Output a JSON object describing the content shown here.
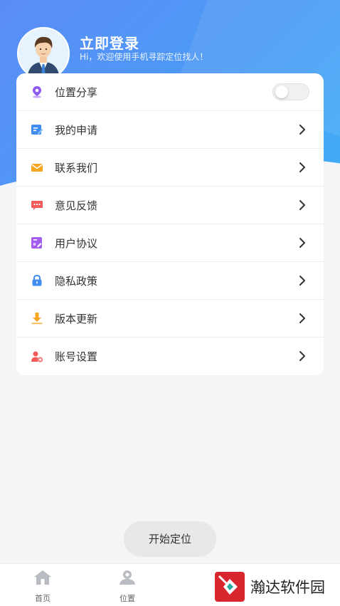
{
  "header": {
    "title": "立即登录",
    "subtitle": "Hi，欢迎使用手机寻踪定位找人！"
  },
  "menu": {
    "items": [
      {
        "label": "位置分享",
        "icon": "location-pin-icon",
        "color": "#8e5af0",
        "control": "toggle",
        "toggle_on": false
      },
      {
        "label": "我的申请",
        "icon": "edit-document-icon",
        "color": "#3f8df0",
        "control": "chevron"
      },
      {
        "label": "联系我们",
        "icon": "envelope-icon",
        "color": "#f5a623",
        "control": "chevron"
      },
      {
        "label": "意见反馈",
        "icon": "chat-bubble-icon",
        "color": "#f05a5a",
        "control": "chevron"
      },
      {
        "label": "用户协议",
        "icon": "agreement-icon",
        "color": "#a45cf0",
        "control": "chevron"
      },
      {
        "label": "隐私政策",
        "icon": "lock-icon",
        "color": "#3f8df0",
        "control": "chevron"
      },
      {
        "label": "版本更新",
        "icon": "download-icon",
        "color": "#f5a623",
        "control": "chevron"
      },
      {
        "label": "账号设置",
        "icon": "user-settings-icon",
        "color": "#f05a5a",
        "control": "chevron"
      }
    ]
  },
  "start_button": {
    "label": "开始定位"
  },
  "tabbar": {
    "tabs": [
      {
        "label": "首页",
        "icon": "home-icon"
      },
      {
        "label": "位置",
        "icon": "location-person-icon"
      }
    ]
  },
  "watermark": {
    "text": "瀚达软件园"
  },
  "colors": {
    "hero_start": "#5b8cf6",
    "hero_end": "#3fb0f7",
    "background": "#f4f5f7"
  }
}
